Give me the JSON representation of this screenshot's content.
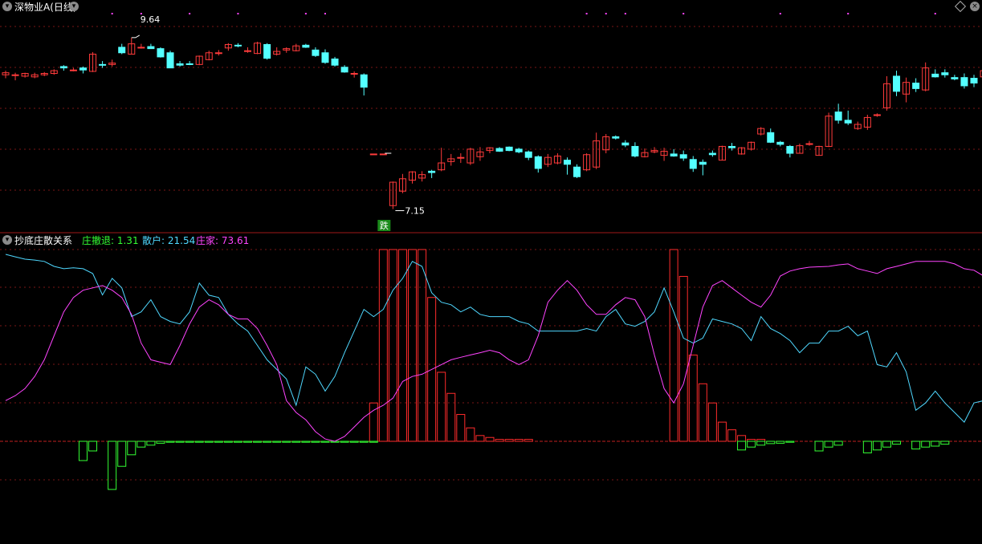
{
  "main_panel": {
    "title": "深物业A(日线)",
    "high_label": "9.64",
    "low_label": "7.15",
    "signal_label": "跌"
  },
  "indicator_panel": {
    "title": "抄底庄散关系",
    "legend": [
      {
        "label": "庄撤退: 1.31",
        "color": "#33ff33"
      },
      {
        "label": "散户: 21.54",
        "color": "#4fd8ff"
      },
      {
        "label": "庄家: 73.61",
        "color": "#ff44ff"
      }
    ]
  },
  "colors": {
    "up": "#ff3b3b",
    "down": "#54ffff",
    "grid": "#7a1616",
    "border": "#a01818",
    "retail": "#4fd8ff",
    "dealer": "#ff44ff",
    "withdraw": "#33ff33",
    "bottom_bar": "#ff2b2b"
  },
  "chart_data": [
    {
      "type": "candlestick",
      "title": "深物业A(日线)",
      "ylim": [
        6.9,
        10.0
      ],
      "annotations": [
        {
          "text": "9.64",
          "index": 13,
          "value": 9.64
        },
        {
          "text": "7.15",
          "index": 40,
          "value": 7.15
        },
        {
          "text": "跌",
          "index": 39,
          "value": 7.05
        }
      ],
      "ohlc": [
        [
          9.1,
          9.16,
          9.05,
          9.13
        ],
        [
          9.1,
          9.13,
          9.02,
          9.1
        ],
        [
          9.08,
          9.13,
          9.06,
          9.12
        ],
        [
          9.07,
          9.13,
          9.05,
          9.1
        ],
        [
          9.1,
          9.14,
          9.08,
          9.12
        ],
        [
          9.12,
          9.18,
          9.1,
          9.16
        ],
        [
          9.22,
          9.24,
          9.16,
          9.2
        ],
        [
          9.17,
          9.2,
          9.15,
          9.17
        ],
        [
          9.2,
          9.22,
          9.12,
          9.17
        ],
        [
          9.15,
          9.43,
          9.14,
          9.4
        ],
        [
          9.25,
          9.3,
          9.2,
          9.24
        ],
        [
          9.25,
          9.32,
          9.22,
          9.27
        ],
        [
          9.5,
          9.55,
          9.4,
          9.42
        ],
        [
          9.4,
          9.64,
          9.4,
          9.55
        ],
        [
          9.5,
          9.55,
          9.48,
          9.5
        ],
        [
          9.51,
          9.55,
          9.48,
          9.48
        ],
        [
          9.48,
          9.5,
          9.35,
          9.36
        ],
        [
          9.42,
          9.45,
          9.2,
          9.2
        ],
        [
          9.26,
          9.3,
          9.22,
          9.24
        ],
        [
          9.26,
          9.3,
          9.24,
          9.25
        ],
        [
          9.25,
          9.38,
          9.24,
          9.37
        ],
        [
          9.32,
          9.45,
          9.31,
          9.42
        ],
        [
          9.41,
          9.46,
          9.38,
          9.42
        ],
        [
          9.49,
          9.56,
          9.45,
          9.54
        ],
        [
          9.53,
          9.56,
          9.5,
          9.52
        ],
        [
          9.45,
          9.5,
          9.42,
          9.45
        ],
        [
          9.41,
          9.58,
          9.4,
          9.56
        ],
        [
          9.54,
          9.56,
          9.32,
          9.34
        ],
        [
          9.4,
          9.5,
          9.38,
          9.44
        ],
        [
          9.46,
          9.5,
          9.42,
          9.48
        ],
        [
          9.45,
          9.55,
          9.44,
          9.52
        ],
        [
          9.53,
          9.55,
          9.49,
          9.5
        ],
        [
          9.46,
          9.5,
          9.36,
          9.38
        ],
        [
          9.42,
          9.47,
          9.26,
          9.28
        ],
        [
          9.33,
          9.36,
          9.22,
          9.24
        ],
        [
          9.21,
          9.24,
          9.13,
          9.14
        ],
        [
          9.11,
          9.15,
          9.06,
          9.12
        ],
        [
          9.1,
          9.12,
          8.8,
          8.92
        ],
        [
          7.95,
          7.95,
          7.94,
          7.95
        ],
        [
          7.95,
          7.95,
          7.94,
          7.95
        ],
        [
          7.2,
          7.55,
          7.15,
          7.54
        ],
        [
          7.41,
          7.66,
          7.38,
          7.59
        ],
        [
          7.57,
          7.7,
          7.52,
          7.69
        ],
        [
          7.6,
          7.7,
          7.55,
          7.65
        ],
        [
          7.7,
          7.72,
          7.6,
          7.68
        ],
        [
          7.72,
          8.04,
          7.7,
          7.82
        ],
        [
          7.84,
          7.95,
          7.78,
          7.88
        ],
        [
          7.9,
          7.96,
          7.82,
          7.9
        ],
        [
          7.82,
          8.04,
          7.79,
          8.02
        ],
        [
          7.91,
          8.05,
          7.85,
          7.98
        ],
        [
          8.0,
          8.05,
          7.96,
          8.04
        ],
        [
          8.03,
          8.05,
          7.98,
          7.99
        ],
        [
          8.05,
          8.06,
          7.99,
          8.0
        ],
        [
          8.02,
          8.04,
          7.96,
          7.98
        ],
        [
          7.98,
          8.0,
          7.86,
          7.9
        ],
        [
          7.91,
          7.93,
          7.68,
          7.74
        ],
        [
          7.8,
          7.95,
          7.76,
          7.9
        ],
        [
          7.82,
          7.96,
          7.8,
          7.92
        ],
        [
          7.86,
          7.9,
          7.65,
          7.8
        ],
        [
          7.76,
          7.8,
          7.6,
          7.62
        ],
        [
          7.72,
          7.96,
          7.7,
          7.94
        ],
        [
          7.76,
          8.26,
          7.73,
          8.14
        ],
        [
          8.01,
          8.24,
          7.96,
          8.2
        ],
        [
          8.2,
          8.22,
          8.16,
          8.18
        ],
        [
          8.11,
          8.15,
          8.05,
          8.08
        ],
        [
          8.06,
          8.12,
          7.9,
          7.92
        ],
        [
          7.91,
          8.03,
          7.9,
          7.97
        ],
        [
          7.98,
          8.05,
          7.96,
          8.0
        ],
        [
          7.93,
          8.04,
          7.85,
          7.99
        ],
        [
          7.95,
          8.02,
          7.91,
          7.92
        ],
        [
          7.94,
          8.0,
          7.85,
          7.89
        ],
        [
          7.87,
          7.92,
          7.69,
          7.74
        ],
        [
          7.83,
          7.87,
          7.64,
          7.8
        ],
        [
          7.96,
          8.0,
          7.91,
          7.94
        ],
        [
          7.86,
          8.07,
          7.86,
          8.06
        ],
        [
          8.06,
          8.11,
          8.0,
          8.04
        ],
        [
          7.95,
          8.05,
          7.94,
          8.04
        ],
        [
          8.02,
          8.13,
          8.0,
          8.12
        ],
        [
          8.24,
          8.34,
          8.22,
          8.32
        ],
        [
          8.26,
          8.32,
          8.11,
          8.12
        ],
        [
          8.12,
          8.14,
          8.06,
          8.09
        ],
        [
          8.06,
          8.08,
          7.9,
          7.96
        ],
        [
          7.96,
          8.1,
          7.96,
          8.07
        ],
        [
          8.1,
          8.14,
          8.07,
          8.1
        ],
        [
          7.93,
          8.07,
          7.93,
          8.06
        ],
        [
          8.06,
          8.55,
          8.05,
          8.5
        ],
        [
          8.56,
          8.68,
          8.39,
          8.44
        ],
        [
          8.44,
          8.58,
          8.37,
          8.4
        ],
        [
          8.32,
          8.42,
          8.3,
          8.38
        ],
        [
          8.34,
          8.52,
          8.3,
          8.48
        ],
        [
          8.51,
          8.54,
          8.49,
          8.52
        ],
        [
          8.62,
          9.08,
          8.58,
          8.97
        ],
        [
          9.08,
          9.16,
          8.79,
          8.86
        ],
        [
          8.82,
          9.06,
          8.7,
          8.99
        ],
        [
          8.98,
          9.05,
          8.85,
          8.9
        ],
        [
          8.88,
          9.28,
          8.86,
          9.2
        ],
        [
          9.11,
          9.18,
          9.06,
          9.07
        ],
        [
          9.13,
          9.18,
          9.06,
          9.1
        ],
        [
          9.06,
          9.1,
          9.02,
          9.04
        ],
        [
          9.06,
          9.12,
          8.9,
          8.94
        ],
        [
          9.05,
          9.1,
          8.92,
          8.98
        ],
        [
          9.07,
          9.18,
          9.02,
          9.16
        ],
        [
          9.1,
          9.26,
          9.05,
          9.22
        ],
        [
          9.18,
          9.26,
          9.1,
          9.16
        ],
        [
          9.04,
          9.2,
          9.02,
          9.1
        ]
      ]
    },
    {
      "type": "line",
      "title": "抄底庄散关系",
      "ylim": [
        -30,
        100
      ],
      "series": [
        {
          "name": "散户",
          "values": [
            97.5,
            96.2,
            95,
            94.5,
            93.8,
            91.2,
            90,
            90.5,
            90,
            87.5,
            76.3,
            85,
            80,
            65,
            67.5,
            73.8,
            65,
            62.5,
            61.2,
            67.5,
            82.5,
            76.2,
            75,
            66.2,
            61.2,
            57.5,
            50,
            42.5,
            37.5,
            32.5,
            18.8,
            38.8,
            35,
            26.2,
            33.8,
            46.2,
            57.5,
            68.8,
            65,
            68.8,
            78.8,
            85,
            93.8,
            91.2,
            77.5,
            72.5,
            71.2,
            67.5,
            70,
            66.2,
            65,
            65,
            65,
            62.5,
            61.2,
            57.5,
            57.5,
            57.5,
            57.5,
            57.5,
            58.8,
            57.5,
            65,
            68.8,
            61.2,
            60,
            62.5,
            67.5,
            80,
            67.5,
            53.8,
            51.2,
            53.8,
            63.8,
            62.5,
            61.2,
            58.8,
            52.5,
            65,
            58.8,
            56.2,
            52.5,
            46.2,
            51.2,
            51.2,
            57.5,
            57.5,
            60,
            55,
            57.5,
            40,
            38.8,
            46.2,
            36.2,
            16.2,
            20,
            26.2,
            20,
            15,
            10,
            20,
            21.2,
            16.2,
            8.8,
            17.5,
            15,
            21.2,
            18.8
          ]
        },
        {
          "name": "庄家",
          "values": [
            21.2,
            23.8,
            27.5,
            33.8,
            42.5,
            55,
            67.5,
            75,
            78.8,
            80,
            81.2,
            78.8,
            75,
            66.2,
            51.2,
            42.5,
            41.2,
            40,
            50,
            61.2,
            70,
            73.8,
            71.2,
            66.2,
            63.8,
            63.8,
            58.8,
            50,
            40,
            21.2,
            15,
            11.2,
            5,
            1.2,
            0,
            2.5,
            7.5,
            12.5,
            16.2,
            18.8,
            22.5,
            31.2,
            33.8,
            35,
            37.5,
            40,
            42.5,
            43.8,
            45,
            46.2,
            47.5,
            46.2,
            42.5,
            40,
            42.5,
            55,
            72.5,
            78.8,
            83.8,
            78.8,
            71.2,
            66.2,
            66.2,
            71.2,
            75,
            73.8,
            65,
            45,
            27.5,
            20,
            30,
            50,
            70,
            81.2,
            83.8,
            80,
            76.2,
            72.5,
            70,
            76.2,
            86.2,
            88.8,
            90,
            90.8,
            91,
            91.2,
            92,
            92.5,
            90,
            88.8,
            87.5,
            90,
            91.2,
            92.5,
            93.8,
            93.8,
            93.8,
            93.8,
            92.5,
            90,
            89.2,
            86.2,
            82.5,
            80,
            80,
            81.2,
            82.5,
            83.8,
            83.8
          ]
        }
      ],
      "bars": [
        {
          "name": "庄撤退",
          "values": [
            -10,
            -5,
            -25,
            -13,
            -7,
            -3,
            -2,
            -1,
            -0.5,
            -0.5,
            -0.5,
            -0.5,
            -0.5,
            -0.5,
            -0.5,
            -0.5,
            -0.5,
            -0.5,
            -0.5,
            -0.5,
            -0.5,
            -0.5,
            -0.5,
            -0.5,
            -0.5,
            -0.5,
            -0.5,
            -0.5,
            -0.5,
            -0.5,
            -4.5,
            -3,
            -2,
            -1.2,
            -1,
            -0.5,
            -5,
            -3,
            -2,
            -6,
            -4.5,
            -3,
            -1.5,
            -4,
            -3,
            -2.5,
            -1.5
          ]
        },
        {
          "name": "bottom_signal",
          "values": [
            0,
            0,
            20,
            100,
            100,
            100,
            100,
            100,
            75,
            36,
            25,
            14,
            7,
            3,
            2,
            1,
            1,
            1,
            1,
            100,
            86,
            45,
            30,
            20,
            10,
            6,
            3,
            1,
            1
          ]
        }
      ],
      "bar_positions": {
        "withdraw_start_index": 8,
        "bottom_signal_start_index": 36,
        "bottom_signal_second_start": 55
      }
    }
  ]
}
